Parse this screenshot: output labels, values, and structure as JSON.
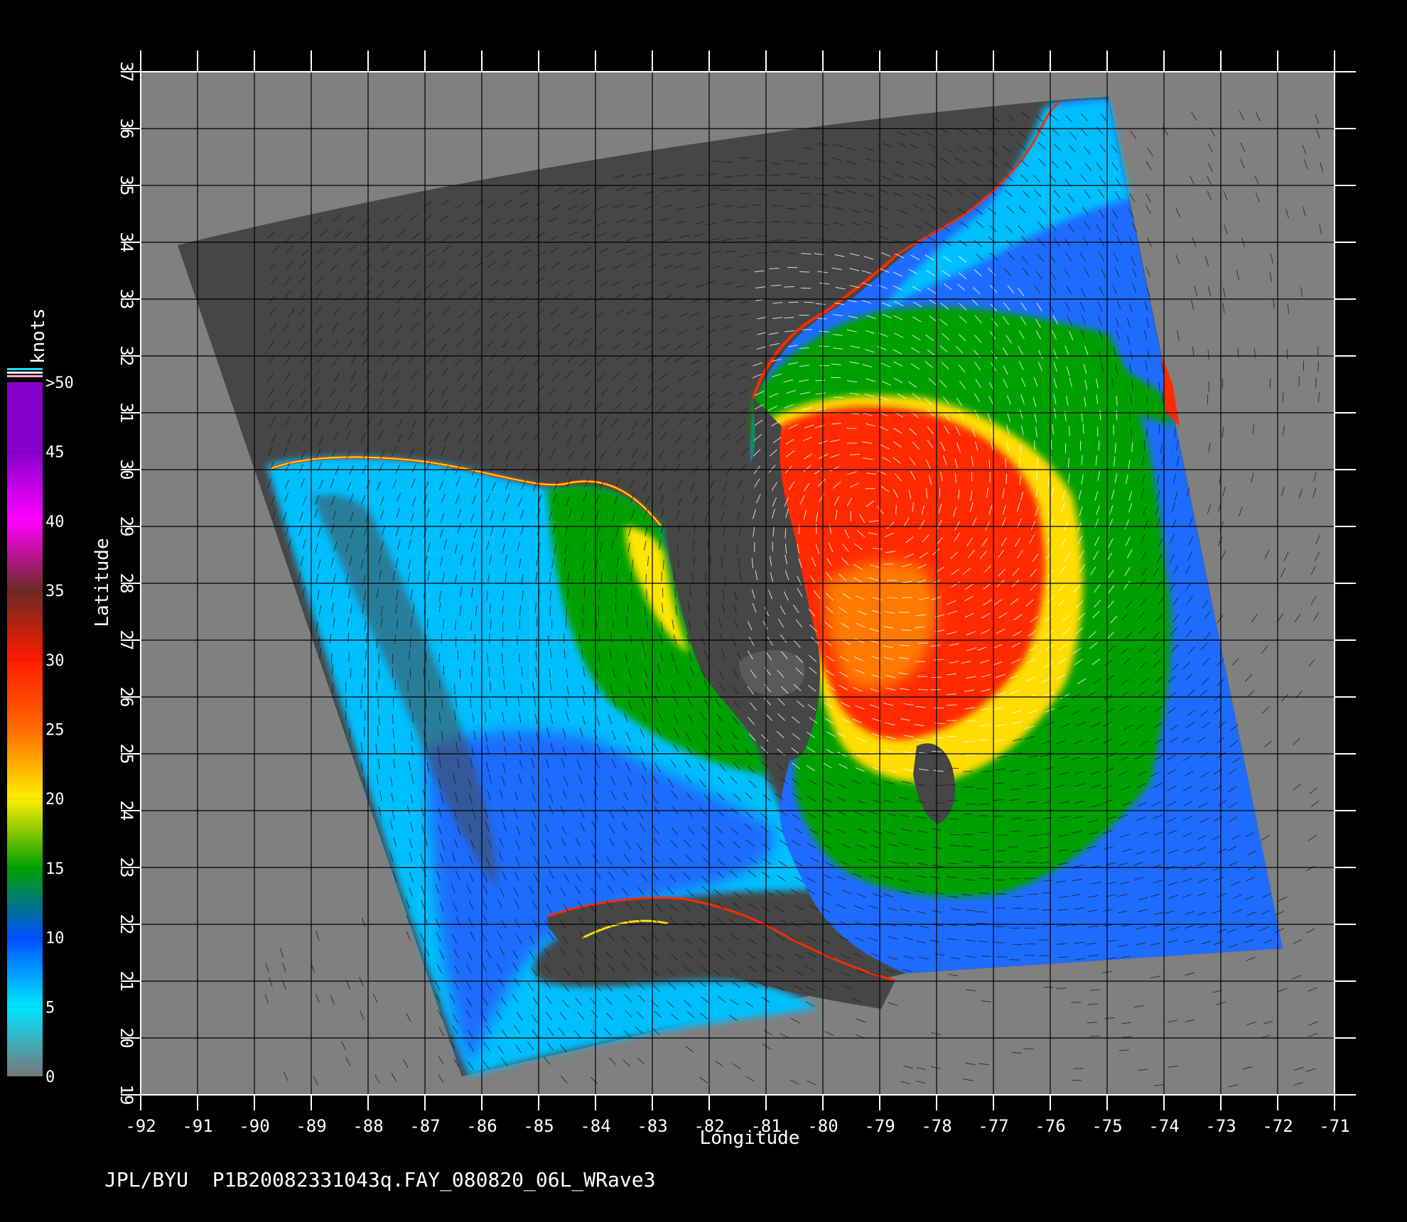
{
  "figure": {
    "caption": "JPL/BYU  P1B20082331043q.FAY_080820_06L_WRave3"
  },
  "map": {
    "lon_range": [
      -92,
      -71
    ],
    "lat_range": [
      19,
      37
    ],
    "xlabel": "Longitude",
    "ylabel": "Latitude",
    "x_ticks": [
      "-92",
      "-91",
      "-90",
      "-89",
      "-88",
      "-87",
      "-86",
      "-85",
      "-84",
      "-83",
      "-82",
      "-81",
      "-80",
      "-79",
      "-78",
      "-77",
      "-76",
      "-75",
      "-74",
      "-73",
      "-72",
      "-71"
    ],
    "y_ticks": [
      "19",
      "20",
      "21",
      "22",
      "23",
      "24",
      "25",
      "26",
      "27",
      "28",
      "29",
      "30",
      "31",
      "32",
      "33",
      "34",
      "35",
      "36",
      "37"
    ],
    "background_color": "#808080",
    "land_color": "#555555",
    "grid": true
  },
  "colorbar": {
    "unit": "knots",
    "labels": [
      "0",
      "5",
      "10",
      "15",
      "20",
      "25",
      "30",
      "35",
      "40",
      "45",
      ">50"
    ],
    "values": [
      0,
      5,
      10,
      15,
      20,
      25,
      30,
      35,
      40,
      45,
      50
    ],
    "colors": [
      "#777777",
      "#00e5ff",
      "#0050ff",
      "#00a000",
      "#ffee00",
      "#ff6a00",
      "#ff1a00",
      "#6b2a22",
      "#ff00ff",
      "#8800cc"
    ]
  }
}
